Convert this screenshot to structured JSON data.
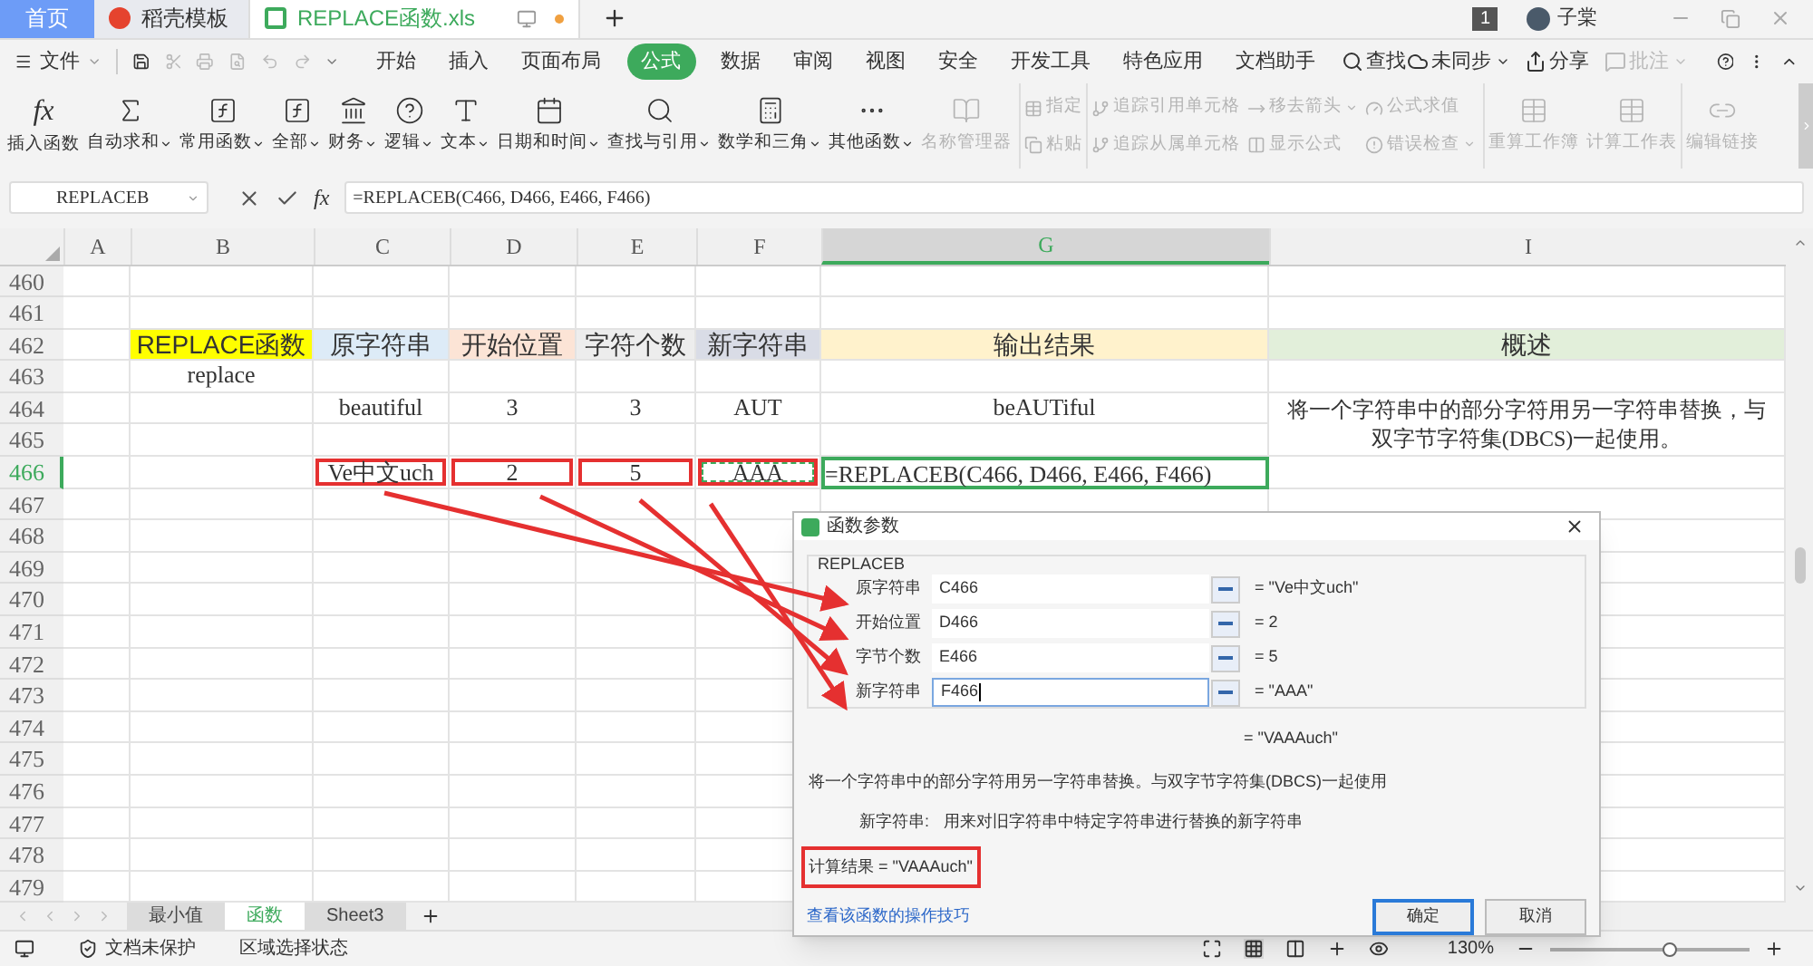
{
  "tabs": [
    {
      "label": "首页",
      "selected": false,
      "kind": "home"
    },
    {
      "label": "稻壳模板",
      "selected": false,
      "kind": "docer"
    },
    {
      "label": "REPLACE函数.xls",
      "selected": true,
      "kind": "sheet"
    }
  ],
  "account": {
    "badge": "1",
    "user": "子棠"
  },
  "menu": {
    "file": "文件",
    "items": [
      {
        "label": "开始",
        "selected": false
      },
      {
        "label": "插入",
        "selected": false
      },
      {
        "label": "页面布局",
        "selected": false
      },
      {
        "label": "公式",
        "selected": true
      },
      {
        "label": "数据",
        "selected": false
      },
      {
        "label": "审阅",
        "selected": false
      },
      {
        "label": "视图",
        "selected": false
      },
      {
        "label": "安全",
        "selected": false
      },
      {
        "label": "开发工具",
        "selected": false
      },
      {
        "label": "特色应用",
        "selected": false
      },
      {
        "label": "文档助手",
        "selected": false
      }
    ],
    "search": "查找",
    "actions": [
      {
        "label": "未同步",
        "dropdown": true,
        "disabled": false
      },
      {
        "label": "分享",
        "dropdown": false,
        "disabled": false
      },
      {
        "label": "批注",
        "dropdown": true,
        "disabled": true
      }
    ]
  },
  "ribbon": [
    {
      "kind": "large",
      "label": "插入函数",
      "icon_text": "fx",
      "dropdown": false,
      "disabled": false
    },
    {
      "kind": "large",
      "label": "自动求和",
      "dropdown": true,
      "disabled": false
    },
    {
      "kind": "large",
      "label": "常用函数",
      "dropdown": true,
      "disabled": false
    },
    {
      "kind": "large",
      "label": "全部",
      "dropdown": true,
      "disabled": false
    },
    {
      "kind": "large",
      "label": "财务",
      "dropdown": true,
      "disabled": false
    },
    {
      "kind": "large",
      "label": "逻辑",
      "dropdown": true,
      "disabled": false
    },
    {
      "kind": "large",
      "label": "文本",
      "dropdown": true,
      "disabled": false
    },
    {
      "kind": "large",
      "label": "日期和时间",
      "dropdown": true,
      "disabled": false
    },
    {
      "kind": "large",
      "label": "查找与引用",
      "dropdown": true,
      "disabled": false
    },
    {
      "kind": "large",
      "label": "数学和三角",
      "dropdown": true,
      "disabled": false
    },
    {
      "kind": "large",
      "label": "其他函数",
      "dropdown": true,
      "disabled": false
    },
    {
      "kind": "large",
      "label": "名称管理器",
      "dropdown": false,
      "disabled": true
    },
    {
      "kind": "stack",
      "items": [
        {
          "label": "指定",
          "dropdown": false,
          "disabled": true
        },
        {
          "label": "粘贴",
          "dropdown": false,
          "disabled": true
        }
      ]
    },
    {
      "kind": "stack",
      "items": [
        {
          "label": "追踪引用单元格",
          "dropdown": false,
          "disabled": true
        },
        {
          "label": "追踪从属单元格",
          "dropdown": false,
          "disabled": true
        }
      ]
    },
    {
      "kind": "stack",
      "items": [
        {
          "label": "移去箭头",
          "dropdown": true,
          "disabled": true
        },
        {
          "label": "显示公式",
          "dropdown": false,
          "disabled": true
        }
      ]
    },
    {
      "kind": "stack",
      "items": [
        {
          "label": "公式求值",
          "dropdown": false,
          "disabled": true
        },
        {
          "label": "错误检查",
          "dropdown": true,
          "disabled": true
        }
      ]
    },
    {
      "kind": "large",
      "label": "重算工作簿",
      "dropdown": false,
      "disabled": true
    },
    {
      "kind": "large",
      "label": "计算工作表",
      "dropdown": false,
      "disabled": true
    },
    {
      "kind": "large",
      "label": "编辑链接",
      "dropdown": false,
      "disabled": true
    }
  ],
  "formula_bar": {
    "fx": "fx",
    "name_box": "REPLACEB",
    "formula": "=REPLACEB(C466, D466, E466, F466)"
  },
  "columns": [
    {
      "label": "A",
      "selected": false
    },
    {
      "label": "B",
      "selected": false
    },
    {
      "label": "C",
      "selected": false
    },
    {
      "label": "D",
      "selected": false
    },
    {
      "label": "E",
      "selected": false
    },
    {
      "label": "F",
      "selected": false
    },
    {
      "label": "G",
      "selected": true
    },
    {
      "label": "I",
      "selected": false
    }
  ],
  "rows": [
    {
      "number": "460",
      "selected": false,
      "cells": {}
    },
    {
      "number": "461",
      "selected": false,
      "cells": {}
    },
    {
      "number": "462",
      "selected": false,
      "cells": {
        "B": {
          "text": "REPLACE函数",
          "color": "#ffff00"
        },
        "C": {
          "text": "原字符串",
          "color": "#ddebf7"
        },
        "D": {
          "text": "开始位置",
          "color": "#fce4d6"
        },
        "E": {
          "text": "字符个数",
          "color": "#ededed"
        },
        "F": {
          "text": "新字符串",
          "color": "#d9dce6"
        },
        "G": {
          "text": "输出结果",
          "color": "#fff2cc"
        },
        "I": {
          "text": "概述",
          "color": "#e2efda"
        }
      }
    },
    {
      "number": "463",
      "selected": false,
      "cells": {
        "B": {
          "text": "replace"
        }
      }
    },
    {
      "number": "464",
      "selected": false,
      "cells": {
        "C": {
          "text": "beautiful"
        },
        "D": {
          "text": "3"
        },
        "E": {
          "text": "3"
        },
        "F": {
          "text": "AUT"
        },
        "G": {
          "text": "beAUTiful"
        },
        "I": {
          "text": "将一个字符串中的部分字符用另一字符串替换，与双字节字符集(DBCS)一起使用。",
          "merged": true
        }
      }
    },
    {
      "number": "465",
      "selected": false,
      "cells": {}
    },
    {
      "number": "466",
      "selected": true,
      "cells": {
        "C": {
          "text": "Ve中文uch",
          "highlight": true
        },
        "D": {
          "text": "2",
          "highlight": true
        },
        "E": {
          "text": "5",
          "highlight": true
        },
        "F": {
          "text": "AAA",
          "highlight": true,
          "marquee": true
        },
        "G": {
          "text": "=REPLACEB(C466, D466, E466, F466)",
          "active": true
        }
      }
    },
    {
      "number": "467",
      "selected": false,
      "cells": {}
    },
    {
      "number": "468",
      "selected": false,
      "cells": {}
    },
    {
      "number": "469",
      "selected": false,
      "cells": {}
    },
    {
      "number": "470",
      "selected": false,
      "cells": {}
    },
    {
      "number": "471",
      "selected": false,
      "cells": {}
    },
    {
      "number": "472",
      "selected": false,
      "cells": {}
    },
    {
      "number": "473",
      "selected": false,
      "cells": {}
    },
    {
      "number": "474",
      "selected": false,
      "cells": {}
    },
    {
      "number": "475",
      "selected": false,
      "cells": {}
    },
    {
      "number": "476",
      "selected": false,
      "cells": {}
    },
    {
      "number": "477",
      "selected": false,
      "cells": {}
    },
    {
      "number": "478",
      "selected": false,
      "cells": {}
    },
    {
      "number": "479",
      "selected": false,
      "cells": {}
    }
  ],
  "sheet_tabs": [
    {
      "label": "最小值",
      "selected": false
    },
    {
      "label": "函数",
      "selected": true
    },
    {
      "label": "Sheet3",
      "selected": false
    }
  ],
  "status_bar": {
    "protection": "文档未保护",
    "mode": "区域选择状态",
    "zoom": "130%",
    "level": 0.6
  },
  "dialog": {
    "title": "函数参数",
    "function": "REPLACEB",
    "args": [
      {
        "label": "原字符串",
        "ref": "C466",
        "value": "= \"Ve中文uch\"",
        "focused": false
      },
      {
        "label": "开始位置",
        "ref": "D466",
        "value": "= 2",
        "focused": false
      },
      {
        "label": "字节个数",
        "ref": "E466",
        "value": "= 5",
        "focused": false
      },
      {
        "label": "新字符串",
        "ref": "F466",
        "value": "= \"AAA\"",
        "focused": true
      }
    ],
    "result": "= \"VAAAuch\"",
    "description": "将一个字符串中的部分字符用另一字符串替换。与双字节字符集(DBCS)一起使用",
    "arg_help": {
      "label": "新字符串:",
      "text": "用来对旧字符串中特定字符串进行替换的新字符串"
    },
    "calc_result": "计算结果 = \"VAAAuch\"",
    "link": "查看该函数的操作技巧",
    "buttons": [
      {
        "label": "确定",
        "default": true
      },
      {
        "label": "取消",
        "default": false
      }
    ]
  }
}
